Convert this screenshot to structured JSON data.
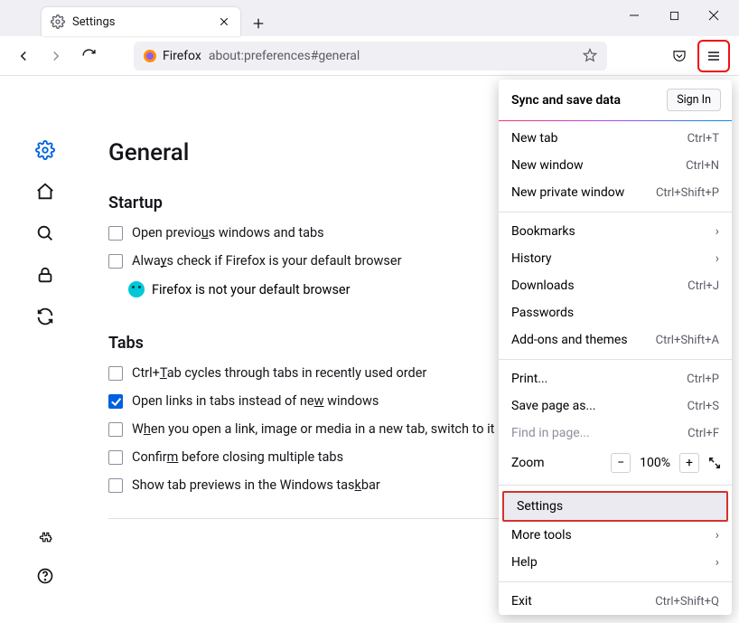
{
  "window": {
    "tab_title": "Settings",
    "url_label": "Firefox",
    "url_path": "about:preferences#general"
  },
  "page": {
    "title": "General",
    "startup": {
      "heading": "Startup",
      "restore_label_pre": "Open previo",
      "restore_label_ul": "u",
      "restore_label_post": "s windows and tabs",
      "default_label_pre": "Alwa",
      "default_label_ul": "y",
      "default_label_post": "s check if Firefox is your default browser",
      "default_status": "Firefox is not your default browser"
    },
    "tabs": {
      "heading": "Tabs",
      "ctrl_tab_pre": "Ctrl+",
      "ctrl_tab_ul": "T",
      "ctrl_tab_post": "ab cycles through tabs in recently used order",
      "open_links_pre": "Open links in tabs instead of ne",
      "open_links_ul": "w",
      "open_links_post": " windows",
      "switch_pre": "W",
      "switch_ul": "h",
      "switch_post": "en you open a link, image or media in a new tab, switch to it immediately",
      "confirm_pre": "Confir",
      "confirm_ul": "m",
      "confirm_post": " before closing multiple tabs",
      "preview_pre": "Show tab previews in the Windows tas",
      "preview_ul": "k",
      "preview_post": "bar"
    }
  },
  "menu": {
    "sync_title": "Sync and save data",
    "sign_in": "Sign In",
    "new_tab": "New tab",
    "new_tab_sc": "Ctrl+T",
    "new_window": "New window",
    "new_window_sc": "Ctrl+N",
    "new_private": "New private window",
    "new_private_sc": "Ctrl+Shift+P",
    "bookmarks": "Bookmarks",
    "history": "History",
    "downloads": "Downloads",
    "downloads_sc": "Ctrl+J",
    "passwords": "Passwords",
    "addons": "Add-ons and themes",
    "addons_sc": "Ctrl+Shift+A",
    "print": "Print...",
    "print_sc": "Ctrl+P",
    "save_as": "Save page as...",
    "save_as_sc": "Ctrl+S",
    "find": "Find in page...",
    "find_sc": "Ctrl+F",
    "zoom": "Zoom",
    "zoom_value": "100%",
    "settings": "Settings",
    "more_tools": "More tools",
    "help": "Help",
    "exit": "Exit",
    "exit_sc": "Ctrl+Shift+Q"
  }
}
